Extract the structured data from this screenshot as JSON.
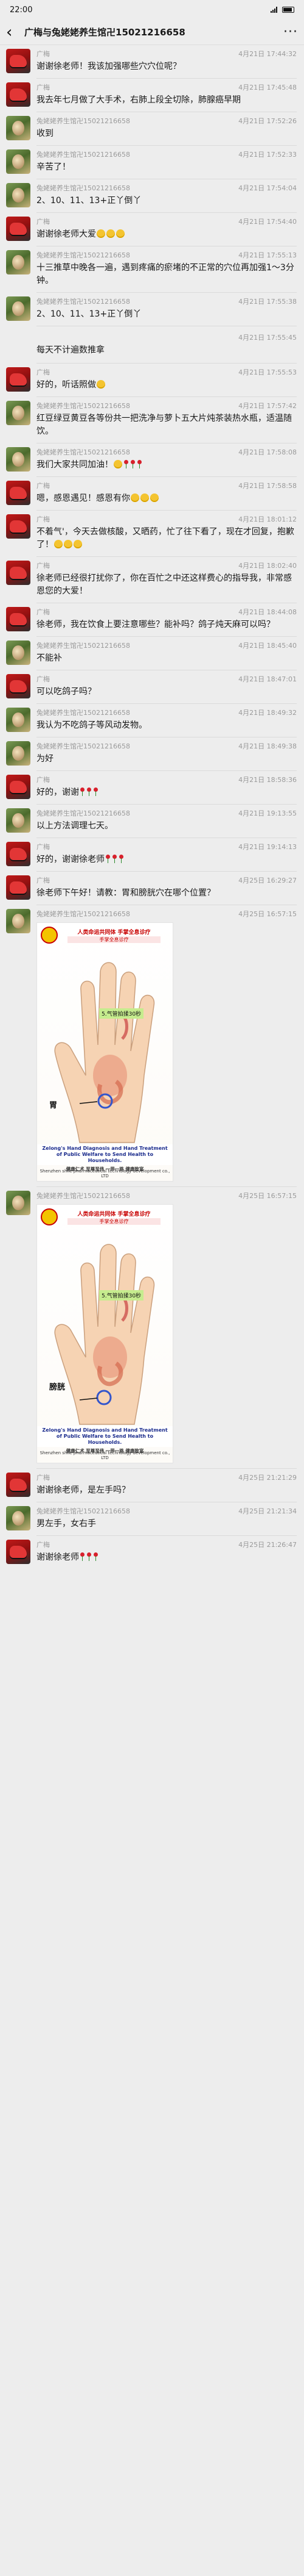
{
  "status": {
    "time": "22:00"
  },
  "header": {
    "back_icon": "chevron-left-icon",
    "title": "广梅与兔姥姥养生馆卍15021216658",
    "more_icon": "more-icon"
  },
  "messages": [
    {
      "sender": "广梅",
      "time": "4月21日 17:44:32",
      "avatar": "gm",
      "text": "谢谢徐老师！我该加强哪些穴穴位呢？"
    },
    {
      "sender": "广梅",
      "time": "4月21日 17:45:48",
      "avatar": "gm",
      "text": "我去年七月做了大手术，右肺上段全切除，肺腺癌早期"
    },
    {
      "sender": "兔姥姥养生馆卍15021216658",
      "time": "4月21日 17:52:26",
      "avatar": "tu",
      "text": "收到"
    },
    {
      "sender": "兔姥姥养生馆卍15021216658",
      "time": "4月21日 17:52:33",
      "avatar": "tu",
      "text": "辛苦了！"
    },
    {
      "sender": "兔姥姥养生馆卍15021216658",
      "time": "4月21日 17:54:04",
      "avatar": "tu",
      "text": "2、10、11、13+正丫倒丫"
    },
    {
      "sender": "广梅",
      "time": "4月21日 17:54:40",
      "avatar": "gm",
      "text": "谢谢徐老师大爱🙏🙏🙏"
    },
    {
      "sender": "兔姥姥养生馆卍15021216658",
      "time": "4月21日 17:55:13",
      "avatar": "tu",
      "text": "十三推草中晚各一遍，遇到疼痛的瘀堵的不正常的穴位再加强1～3分钟。"
    },
    {
      "sender": "兔姥姥养生馆卍15021216658",
      "time": "4月21日 17:55:38",
      "avatar": "tu",
      "text": "2、10、11、13+正丫倒丫",
      "extra": [
        {
          "time": "4月21日 17:55:45",
          "text": "每天不计遍数推拿"
        }
      ]
    },
    {
      "sender": "广梅",
      "time": "4月21日 17:55:53",
      "avatar": "gm",
      "text": "好的，听话照做😊"
    },
    {
      "sender": "兔姥姥养生馆卍15021216658",
      "time": "4月21日 17:57:42",
      "avatar": "tu",
      "text": "红豆绿豆黄豆各等份共一把洗净与萝卜五大片炖茶装热水瓶，适温随饮。"
    },
    {
      "sender": "兔姥姥养生馆卍15021216658",
      "time": "4月21日 17:58:08",
      "avatar": "tu",
      "text": "我们大家共同加油！👍🌹🌹🌹"
    },
    {
      "sender": "广梅",
      "time": "4月21日 17:58:58",
      "avatar": "gm",
      "text": "嗯，感恩遇见！感恩有你🙏🙏🙏"
    },
    {
      "sender": "广梅",
      "time": "4月21日 18:01:12",
      "avatar": "gm",
      "text": "不着气'，今天去做核酸，又晒药，忙了往下看了，现在才回复，抱歉了！🙏🙏🙏"
    },
    {
      "sender": "广梅",
      "time": "4月21日 18:02:40",
      "avatar": "gm",
      "text": "徐老师已经很打扰你了，你在百忙之中还这样费心的指导我，非常感恩您的大爱！"
    },
    {
      "sender": "广梅",
      "time": "4月21日 18:44:08",
      "avatar": "gm",
      "text": "徐老师，我在饮食上要注意哪些？能补吗？鸽子炖天麻可以吗？"
    },
    {
      "sender": "兔姥姥养生馆卍15021216658",
      "time": "4月21日 18:45:40",
      "avatar": "tu",
      "text": "不能补"
    },
    {
      "sender": "广梅",
      "time": "4月21日 18:47:01",
      "avatar": "gm",
      "text": "可以吃鸽子吗？"
    },
    {
      "sender": "兔姥姥养生馆卍15021216658",
      "time": "4月21日 18:49:32",
      "avatar": "tu",
      "text": "我认为不吃鸽子等风动发物。"
    },
    {
      "sender": "兔姥姥养生馆卍15021216658",
      "time": "4月21日 18:49:38",
      "avatar": "tu",
      "text": "为好"
    },
    {
      "sender": "广梅",
      "time": "4月21日 18:58:36",
      "avatar": "gm",
      "text": "好的，谢谢🌹🌹🌹"
    },
    {
      "sender": "兔姥姥养生馆卍15021216658",
      "time": "4月21日 19:13:55",
      "avatar": "tu",
      "text": "以上方法调理七天。"
    },
    {
      "sender": "广梅",
      "time": "4月21日 19:14:13",
      "avatar": "gm",
      "text": "好的，谢谢徐老师🌹🌹🌹"
    },
    {
      "sender": "广梅",
      "time": "4月25日 16:29:27",
      "avatar": "gm",
      "text": "徐老师下午好！请教：胃和膀胱穴在哪个位置？"
    },
    {
      "sender": "兔姥姥养生馆卍15021216658",
      "time": "4月25日 16:57:15",
      "avatar": "tu",
      "image": {
        "title": "人类命运共同体 手掌全息诊疗",
        "subtitle": "手掌全息诊疗",
        "tag": "5.气管拍揉30秒",
        "organ": "胃",
        "caption": "Zelong's Hand Diagnosis and Hand Treatment of Public Welfare to Send Health to Households.",
        "brand": "健康仁术 至尊至伟 一带一路 健康致富",
        "company": "Shenzhen shile pharmaceutical technology development co., LTD"
      }
    },
    {
      "sender": "兔姥姥养生馆卍15021216658",
      "time": "4月25日 16:57:15",
      "avatar": "tu",
      "image": {
        "title": "人类命运共同体 手掌全息诊疗",
        "subtitle": "手掌全息诊疗",
        "tag": "5.气管拍揉30秒",
        "organ": "膀胱",
        "caption": "Zelong's Hand Diagnosis and Hand Treatment of Public Welfare to Send Health to Households.",
        "brand": "健康仁术 至尊至伟 一带一路 健康致富",
        "company": "Shenzhen shile pharmaceutical technology development co., LTD"
      }
    },
    {
      "sender": "广梅",
      "time": "4月25日 21:21:29",
      "avatar": "gm",
      "text": "谢谢徐老师，是左手吗？"
    },
    {
      "sender": "兔姥姥养生馆卍15021216658",
      "time": "4月25日 21:21:34",
      "avatar": "tu",
      "text": "男左手，女右手"
    },
    {
      "sender": "广梅",
      "time": "4月25日 21:26:47",
      "avatar": "gm",
      "text": "谢谢徐老师🌹🌹🌹"
    }
  ]
}
